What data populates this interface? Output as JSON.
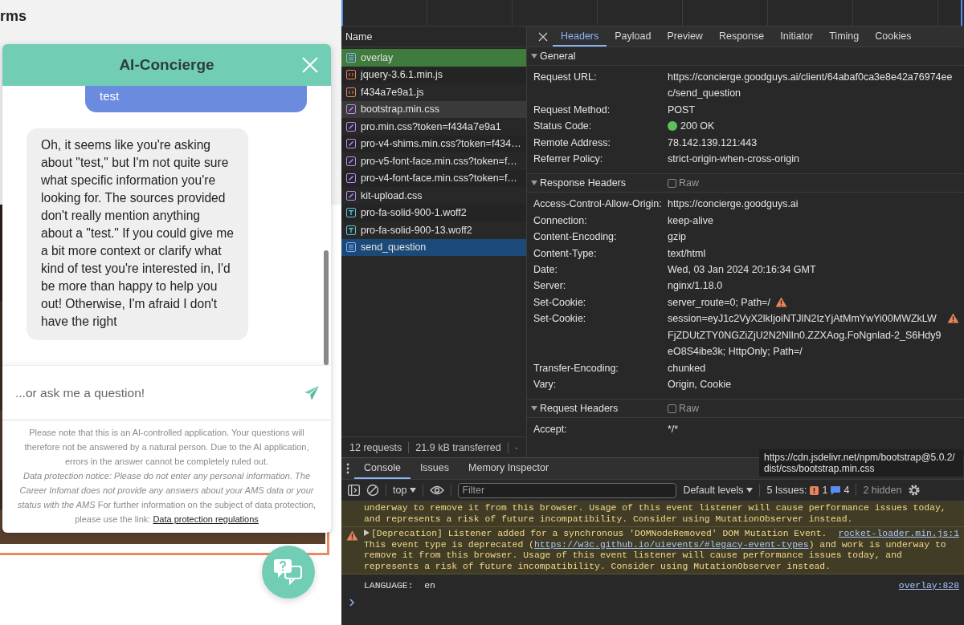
{
  "page": {
    "heading": "rms"
  },
  "chat": {
    "title": "AI-Concierge",
    "messages": [
      {
        "kind": "user",
        "text": "test"
      },
      {
        "kind": "bot",
        "text": "Oh, it seems like you're asking about \"test,\" but I'm not quite sure what specific information you're looking for. The sources provided don't really mention anything about a \"test.\" If you could give me a bit more context or clarify what kind of test you're interested in, I'd be more than happy to help you out! Otherwise, I'm afraid I don't have the right"
      }
    ],
    "input": {
      "placeholder": "...or ask me a question!"
    },
    "notice": "Please note that this is an AI-controlled application. Your questions will therefore not be answered by a natural person. Due to the AI application, errors in the answer cannot be completely ruled out.",
    "privacy": "*Data protection notice: Please do not enter any personal information. The Career Infomat does not provide any answers about your AMS data or your status with the AMS* For further information on the subject of data protection, please use the link:",
    "privacy_link": "Data protection regulations"
  },
  "devtools": {
    "name_header": "Name",
    "requests": [
      {
        "name": "overlay",
        "kind": "doc",
        "selected": false,
        "highlighted": true,
        "hovered": false
      },
      {
        "name": "jquery-3.6.1.min.js",
        "kind": "script",
        "selected": false,
        "highlighted": false,
        "hovered": false
      },
      {
        "name": "f434a7e9a1.js",
        "kind": "script",
        "selected": false,
        "highlighted": false,
        "hovered": false
      },
      {
        "name": "bootstrap.min.css",
        "kind": "css",
        "selected": false,
        "highlighted": false,
        "hovered": true
      },
      {
        "name": "pro.min.css?token=f434a7e9a1",
        "kind": "css",
        "selected": false,
        "highlighted": false,
        "hovered": false
      },
      {
        "name": "pro-v4-shims.min.css?token=f434…",
        "kind": "css",
        "selected": false,
        "highlighted": false,
        "hovered": false
      },
      {
        "name": "pro-v5-font-face.min.css?token=f…",
        "kind": "css",
        "selected": false,
        "highlighted": false,
        "hovered": false
      },
      {
        "name": "pro-v4-font-face.min.css?token=f…",
        "kind": "css",
        "selected": false,
        "highlighted": false,
        "hovered": false
      },
      {
        "name": "kit-upload.css",
        "kind": "css",
        "selected": false,
        "highlighted": false,
        "hovered": false
      },
      {
        "name": "pro-fa-solid-900-1.woff2",
        "kind": "font",
        "selected": false,
        "highlighted": false,
        "hovered": false
      },
      {
        "name": "pro-fa-solid-900-13.woff2",
        "kind": "font",
        "selected": false,
        "highlighted": false,
        "hovered": false
      },
      {
        "name": "send_question",
        "kind": "doc",
        "selected": true,
        "highlighted": false,
        "hovered": false
      }
    ],
    "summary": [
      "12 requests",
      "21.9 kB transferred",
      "·"
    ],
    "detail_tabs": [
      {
        "label": "Headers",
        "selected": true
      },
      {
        "label": "Payload",
        "selected": false
      },
      {
        "label": "Preview",
        "selected": false
      },
      {
        "label": "Response",
        "selected": false
      },
      {
        "label": "Initiator",
        "selected": false
      },
      {
        "label": "Timing",
        "selected": false
      },
      {
        "label": "Cookies",
        "selected": false
      }
    ],
    "sections": [
      {
        "title": "General",
        "rows": [
          {
            "name": "Request URL:",
            "value": "https://concierge.goodguys.ai/client/64abaf0ca3e8e42a76974eec/send_question",
            "kind": "plain"
          },
          {
            "name": "Request Method:",
            "value": "POST",
            "kind": "plain"
          },
          {
            "name": "Status Code:",
            "value": "200 OK",
            "kind": "status"
          },
          {
            "name": "Remote Address:",
            "value": "78.142.139.121:443",
            "kind": "plain"
          },
          {
            "name": "Referrer Policy:",
            "value": "strict-origin-when-cross-origin",
            "kind": "plain"
          }
        ]
      },
      {
        "title": "Response Headers",
        "raw": {
          "label": "Raw",
          "checked": false
        },
        "rows": [
          {
            "name": "Access-Control-Allow-Origin:",
            "value": "https://concierge.goodguys.ai",
            "kind": "plain"
          },
          {
            "name": "Connection:",
            "value": "keep-alive",
            "kind": "plain"
          },
          {
            "name": "Content-Encoding:",
            "value": "gzip",
            "kind": "plain"
          },
          {
            "name": "Content-Type:",
            "value": "text/html",
            "kind": "plain"
          },
          {
            "name": "Date:",
            "value": "Wed, 03 Jan 2024 20:16:34 GMT",
            "kind": "plain"
          },
          {
            "name": "Server:",
            "value": "nginx/1.18.0",
            "kind": "plain"
          },
          {
            "name": "Set-Cookie:",
            "value": "server_route=0; Path=/",
            "kind": "warning"
          },
          {
            "name": "Set-Cookie:",
            "value": "session=eyJ1c2VyX2lkIjoiNTJlN2IzYjAtMmYwYi00MWZkLWFjZDUtZTY0NGZiZjU2N2NlIn0.ZZXAog.FoNgnlad-2_S6Hdy9eO8S4ibe3k; HttpOnly; Path=/",
            "kind": "warning"
          },
          {
            "name": "Transfer-Encoding:",
            "value": "chunked",
            "kind": "plain"
          },
          {
            "name": "Vary:",
            "value": "Origin, Cookie",
            "kind": "plain"
          }
        ]
      },
      {
        "title": "Request Headers",
        "raw": {
          "label": "Raw",
          "checked": false
        },
        "rows": [
          {
            "name": "Accept:",
            "value": "*/*",
            "kind": "plain"
          }
        ]
      }
    ],
    "tooltip": "https://cdn.jsdelivr.net/npm/bootstrap@5.0.2/dist/css/bootstrap.min.css",
    "console": {
      "tabs": [
        {
          "label": "Console",
          "selected": true
        },
        {
          "label": "Issues",
          "selected": false
        },
        {
          "label": "Memory Inspector",
          "selected": false
        }
      ],
      "context": "top",
      "filter_placeholder": "Filter",
      "levels": "Default levels",
      "issues": {
        "label": "5 Issues:",
        "errors": "1",
        "infos": "4"
      },
      "hidden": "2 hidden",
      "messages": [
        {
          "kind": "warning-cont",
          "text": "underway to remove it from this browser. Usage of this event listener will cause performance issues today, and represents a risk of future incompatibility. Consider using MutationObserver instead."
        },
        {
          "kind": "warning",
          "text": "[Deprecation] Listener added for a synchronous 'DOMNodeRemoved' DOM Mutation Event. This event type is deprecated (",
          "link": "https://w3c.github.io/uievents/#legacy-event-types",
          "after": ") and work is underway to remove it from this browser. Usage of this event listener will cause performance issues today, and represents a risk of future incompatibility. Consider using MutationObserver instead.",
          "source": "rocket-loader.min.js:1"
        },
        {
          "kind": "log",
          "text": "LANGUAGE:  en",
          "source": "overlay:828"
        }
      ]
    }
  }
}
